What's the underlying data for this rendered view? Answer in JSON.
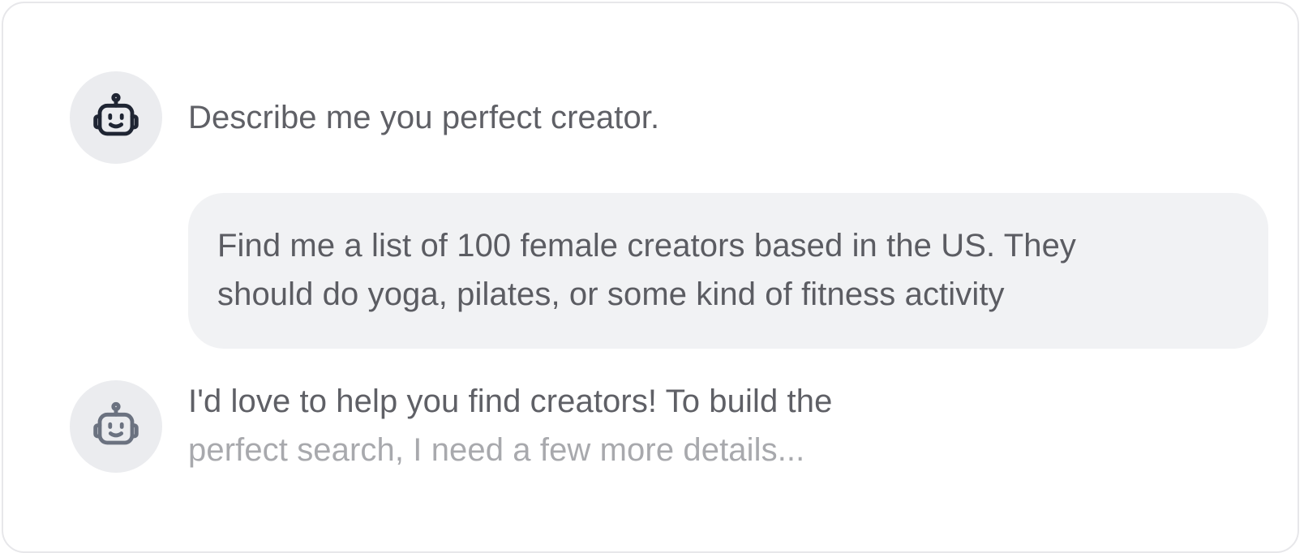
{
  "conversation": {
    "messages": [
      {
        "role": "assistant",
        "avatar_icon": "robot-icon",
        "text": "Describe me you perfect creator."
      },
      {
        "role": "user",
        "lines": [
          "Find me a list of 100 female creators based in the US. They",
          "should do yoga, pilates, or some kind of fitness activity"
        ]
      },
      {
        "role": "assistant",
        "avatar_icon": "robot-icon",
        "streaming": true,
        "lines": [
          "I'd love to help you find creators! To build the",
          "perfect search, I need a few more details..."
        ]
      }
    ]
  },
  "colors": {
    "card_border": "#e7e7ea",
    "avatar_bg": "#ebecef",
    "bubble_bg": "#f1f2f4",
    "text": "#5f6066",
    "text_fading": "#a8a9ad",
    "icon_dark": "#1f2533",
    "icon_muted": "#6b7280"
  }
}
